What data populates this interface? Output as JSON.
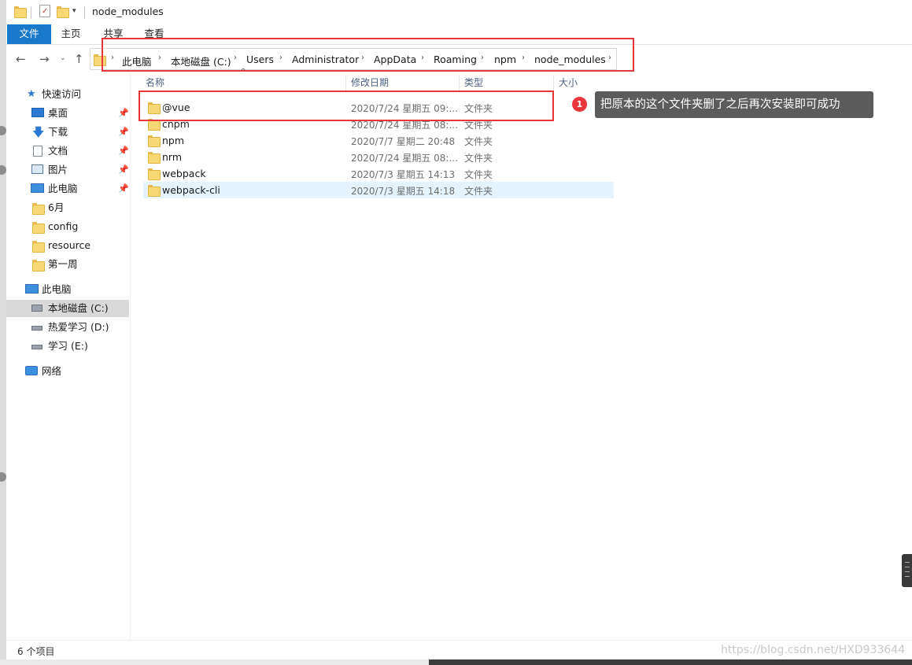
{
  "window": {
    "title": "node_modules"
  },
  "ribbon": {
    "tabs": [
      "文件",
      "主页",
      "共享",
      "查看"
    ]
  },
  "address": {
    "crumbs": [
      "此电脑",
      "本地磁盘 (C:)",
      "Users",
      "Administrator",
      "AppData",
      "Roaming",
      "npm",
      "node_modules"
    ]
  },
  "sidebar": {
    "quick_access": "快速访问",
    "pinned": [
      {
        "label": "桌面",
        "icon": "desktop-icon"
      },
      {
        "label": "下载",
        "icon": "download-icon"
      },
      {
        "label": "文档",
        "icon": "document-icon"
      },
      {
        "label": "图片",
        "icon": "picture-icon"
      },
      {
        "label": "此电脑",
        "icon": "computer-icon"
      }
    ],
    "folders": [
      "6月",
      "config",
      "resource",
      "第一周"
    ],
    "this_pc": "此电脑",
    "drives": [
      "本地磁盘 (C:)",
      "热爱学习 (D:)",
      "学习 (E:)"
    ],
    "network": "网络"
  },
  "columns": {
    "name": "名称",
    "date": "修改日期",
    "type": "类型",
    "size": "大小"
  },
  "files": [
    {
      "name": "@vue",
      "date": "2020/7/24 星期五 09:...",
      "type": "文件夹"
    },
    {
      "name": "cnpm",
      "date": "2020/7/24 星期五 08:...",
      "type": "文件夹"
    },
    {
      "name": "npm",
      "date": "2020/7/7 星期二 20:48",
      "type": "文件夹"
    },
    {
      "name": "nrm",
      "date": "2020/7/24 星期五 08:...",
      "type": "文件夹"
    },
    {
      "name": "webpack",
      "date": "2020/7/3 星期五 14:13",
      "type": "文件夹"
    },
    {
      "name": "webpack-cli",
      "date": "2020/7/3 星期五 14:18",
      "type": "文件夹"
    }
  ],
  "annotation": {
    "number": "1",
    "text": "把原本的这个文件夹删了之后再次安装即可成功"
  },
  "status": {
    "item_count": "6 个项目"
  },
  "watermark": "https://blog.csdn.net/HXD933644",
  "colors": {
    "accent": "#1979ca",
    "highlight_red": "#e8363a",
    "selected_row": "#e5f3ff",
    "folder_yellow": "#f8d775"
  }
}
